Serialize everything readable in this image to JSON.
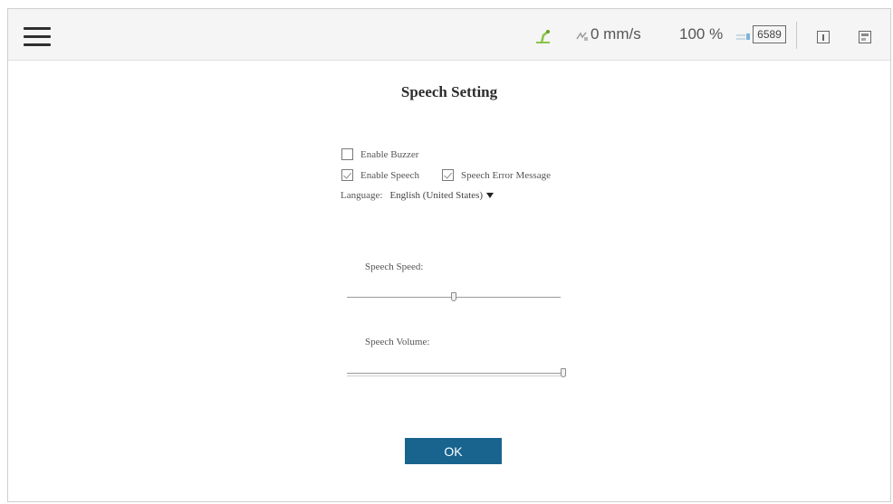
{
  "header": {
    "speed_text": "0 mm/s",
    "override_text": "100 %",
    "counter": "6589"
  },
  "dialog": {
    "title": "Speech Setting",
    "enable_buzzer": {
      "label": "Enable Buzzer",
      "checked": false
    },
    "enable_speech": {
      "label": "Enable Speech",
      "checked": true
    },
    "speech_error_message": {
      "label": "Speech Error Message",
      "checked": true
    },
    "language": {
      "label": "Language:",
      "value": "English (United States)"
    },
    "speech_speed": {
      "label": "Speech Speed:",
      "level_fraction": 0.5
    },
    "speech_volume": {
      "label": "Speech Volume:",
      "level_fraction": 1.0
    },
    "ok_label": "OK"
  },
  "colors": {
    "ok_button": "#19648f",
    "robot_icon": "#8bc34a",
    "signal_icon": "#7fb3d9"
  }
}
